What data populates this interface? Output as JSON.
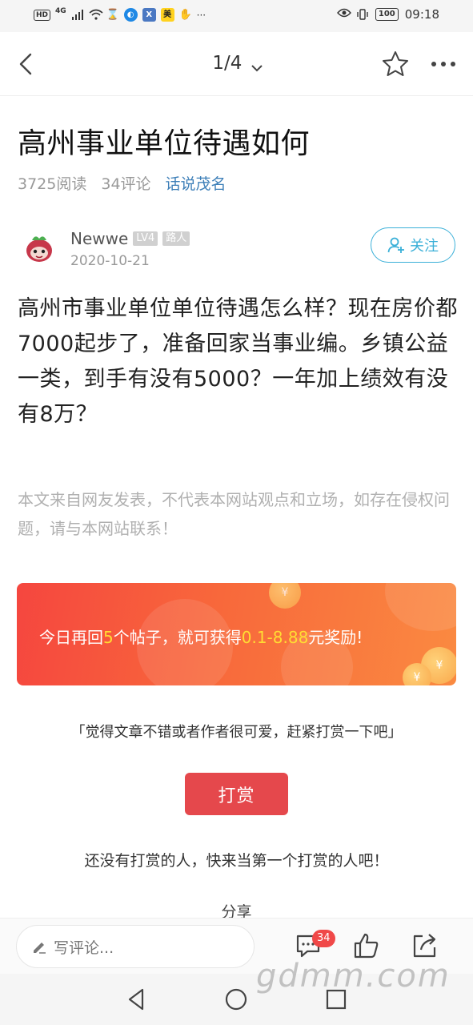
{
  "status_bar": {
    "network_badge": "HD",
    "network_type": "4G",
    "app_icons": [
      "X",
      "⌘",
      "美"
    ],
    "more": "···",
    "battery": "100",
    "time": "09:18"
  },
  "nav": {
    "page_indicator": "1/4"
  },
  "article": {
    "title": "高州事业单位待遇如何",
    "reads": "3725阅读",
    "comments": "34评论",
    "forum": "话说茂名",
    "author": {
      "name": "Newwe",
      "level": "LV4",
      "role": "路人",
      "date": "2020-10-21"
    },
    "follow_label": "关注",
    "body": "高州市事业单位单位待遇怎么样？现在房价都7000起步了，准备回家当事业编。乡镇公益一类，到手有没有5000？一年加上绩效有没有8万？",
    "disclaimer": "本文来自网友发表，不代表本网站观点和立场，如存在侵权问题，请与本网站联系！"
  },
  "promo": {
    "text_1": "今日再回",
    "count": "5",
    "text_2": "个帖子，就可获得",
    "amount": "0.1-8.88",
    "text_3": "元奖励!",
    "coin_symbol": "¥"
  },
  "reward": {
    "note": "「觉得文章不错或者作者很可爱，赶紧打赏一下吧」",
    "button": "打赏",
    "empty": "还没有打赏的人，快来当第一个打赏的人吧！"
  },
  "share_label": "分享",
  "bottom_bar": {
    "comment_placeholder": "写评论...",
    "comment_count": "34"
  },
  "watermark": "gdmm.com",
  "colors": {
    "accent_blue": "#3bb0d8",
    "forum_link": "#3d7fb8",
    "reward_red": "#e5484c",
    "promo_highlight": "#ffdc33"
  }
}
